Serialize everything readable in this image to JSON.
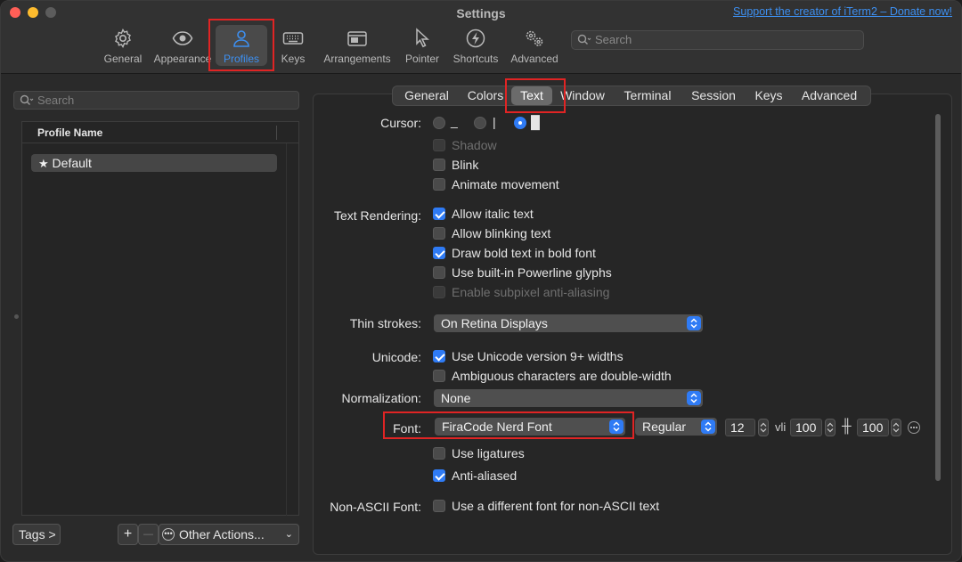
{
  "window": {
    "title": "Settings",
    "donate_link": "Support the creator of iTerm2 – Donate now!"
  },
  "toolbar": {
    "items": [
      {
        "label": "General",
        "icon": "gear-icon"
      },
      {
        "label": "Appearance",
        "icon": "eye-icon"
      },
      {
        "label": "Profiles",
        "icon": "person-icon",
        "selected": true
      },
      {
        "label": "Keys",
        "icon": "keyboard-icon"
      },
      {
        "label": "Arrangements",
        "icon": "window-stack-icon"
      },
      {
        "label": "Pointer",
        "icon": "pointer-icon"
      },
      {
        "label": "Shortcuts",
        "icon": "bolt-icon"
      },
      {
        "label": "Advanced",
        "icon": "gears-icon"
      }
    ],
    "search_placeholder": "Search"
  },
  "sidebar": {
    "search_placeholder": "Search",
    "column_header": "Profile Name",
    "profiles": [
      {
        "name": "Default",
        "default": true
      }
    ],
    "tags_button": "Tags >",
    "add_button": "+",
    "remove_button": "—",
    "other_actions": "Other Actions..."
  },
  "tabs": [
    {
      "label": "General"
    },
    {
      "label": "Colors"
    },
    {
      "label": "Text",
      "active": true
    },
    {
      "label": "Window"
    },
    {
      "label": "Terminal"
    },
    {
      "label": "Session"
    },
    {
      "label": "Keys"
    },
    {
      "label": "Advanced"
    }
  ],
  "text_settings": {
    "cursor": {
      "label": "Cursor:",
      "underline_glyph": "_",
      "vertical_glyph": "|",
      "box_glyph": "█",
      "selected": "box"
    },
    "shadow": {
      "label": "Shadow",
      "checked": false,
      "disabled": true
    },
    "blink": {
      "label": "Blink",
      "checked": false
    },
    "animate_movement": {
      "label": "Animate movement",
      "checked": false
    },
    "text_rendering": {
      "label": "Text Rendering:",
      "allow_italic": {
        "label": "Allow italic text",
        "checked": true
      },
      "allow_blinking": {
        "label": "Allow blinking text",
        "checked": false
      },
      "bold_font": {
        "label": "Draw bold text in bold font",
        "checked": true
      },
      "powerline": {
        "label": "Use built-in Powerline glyphs",
        "checked": false
      },
      "subpixel": {
        "label": "Enable subpixel anti-aliasing",
        "checked": false,
        "disabled": true
      }
    },
    "thin_strokes": {
      "label": "Thin strokes:",
      "value": "On Retina Displays"
    },
    "unicode": {
      "label": "Unicode:",
      "version9": {
        "label": "Use Unicode version 9+ widths",
        "checked": true
      },
      "ambiguous": {
        "label": "Ambiguous characters are double-width",
        "checked": false
      }
    },
    "normalization": {
      "label": "Normalization:",
      "value": "None"
    },
    "font": {
      "label": "Font:",
      "family": "FiraCode Nerd Font",
      "weight": "Regular",
      "size": "12",
      "h_spacing_icon": "vli",
      "h_spacing": "100",
      "v_spacing_icon": "╫",
      "v_spacing": "100",
      "ligatures": {
        "label": "Use ligatures",
        "checked": false
      },
      "anti_aliased": {
        "label": "Anti-aliased",
        "checked": true
      }
    },
    "non_ascii": {
      "label": "Non-ASCII Font:",
      "different_font": {
        "label": "Use a different font for non-ASCII text",
        "checked": false
      }
    }
  },
  "colors": {
    "accent": "#2f7bf5",
    "highlight_box": "#e02424",
    "link": "#3d8ff0"
  }
}
